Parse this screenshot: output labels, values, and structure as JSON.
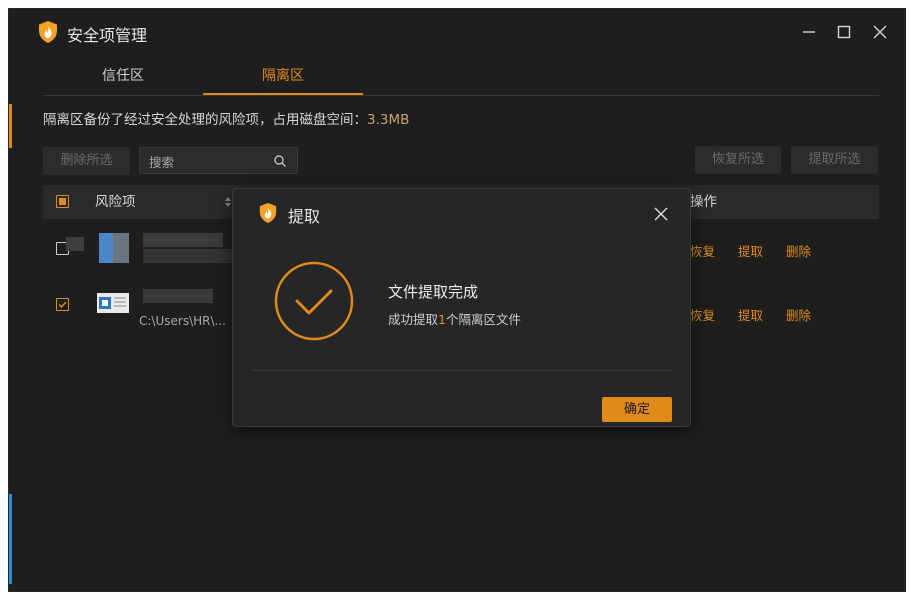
{
  "app": {
    "title": "安全项管理",
    "accent": "#e08a1e"
  },
  "tabs": [
    {
      "label": "信任区",
      "active": false
    },
    {
      "label": "隔离区",
      "active": true
    }
  ],
  "info": {
    "text": "隔离区备份了经过安全处理的风险项，占用磁盘空间：",
    "size": "3.3MB"
  },
  "toolbar": {
    "delete_selected": "删除所选",
    "search_placeholder": "搜索",
    "restore_selected": "恢复所选",
    "extract_selected": "提取所选"
  },
  "table": {
    "col_risk": "风险项",
    "col_actions": "操作",
    "rows": [
      {
        "checked": false,
        "path": "",
        "restore": "恢复",
        "extract": "提取",
        "delete": "删除"
      },
      {
        "checked": true,
        "path": "C:\\Users\\HR\\...",
        "restore": "恢复",
        "extract": "提取",
        "delete": "删除"
      }
    ]
  },
  "dialog": {
    "title": "提取",
    "message_title": "文件提取完成",
    "message_prefix": "成功提取",
    "message_count": "1",
    "message_suffix": "个隔离区文件",
    "ok_label": "确定",
    "icon": "check-circle-icon"
  }
}
